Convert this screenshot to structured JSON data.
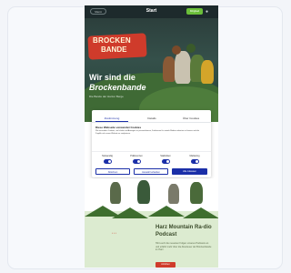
{
  "header": {
    "menu_label": "Menü",
    "title": "Start",
    "join_label": "Mitglied",
    "icon": "user-icon"
  },
  "hero": {
    "logo_line1": "BROCKEN",
    "logo_line2": "BANDE",
    "heading_line1": "Wir sind die",
    "heading_line2": "Brockenbande",
    "subtitle": "Die Bande der Harzer Berge"
  },
  "consent": {
    "tabs": [
      "Zustimmung",
      "Details",
      "Über Cookies"
    ],
    "heading": "Diese Webseite verwendet Cookies",
    "body": "Wir verwenden Cookies, um Inhalte und Anzeigen zu personalisieren, Funktionen für soziale Medien anbieten zu können und die Zugriffe auf unsere Website zu analysieren.",
    "toggles": [
      {
        "label": "Notwendig",
        "on": true
      },
      {
        "label": "Präferenzen",
        "on": true
      },
      {
        "label": "Statistiken",
        "on": true
      },
      {
        "label": "Marketing",
        "on": true
      }
    ],
    "buttons": {
      "deny": "Ablehnen",
      "allow_selection": "Auswahl erlauben",
      "allow_all": "Alle zulassen"
    }
  },
  "podcast": {
    "heading": "Harz Mountain Ra-dio Podcast",
    "text": "Hört euch die neuesten Folgen unseres Podcasts an und erfahrt mehr über die Abenteuer der Brockenbande im Harz.",
    "button": "Anhören"
  },
  "colors": {
    "accent": "#1b2fa8",
    "brand_red": "#cf3b2b",
    "brand_green": "#6bbf3a"
  }
}
